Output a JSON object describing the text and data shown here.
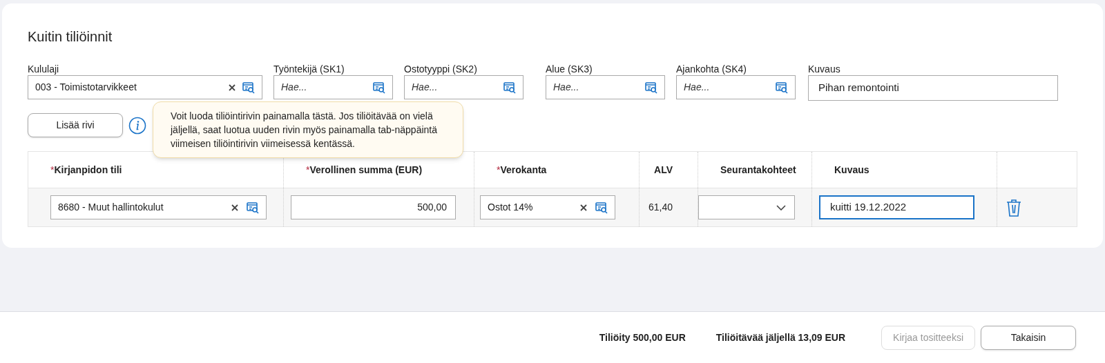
{
  "title": "Kuitin tiliöinnit",
  "filters": [
    {
      "label": "Kululaji",
      "value": "003 - Toimistotarvikkeet",
      "clearable": true
    },
    {
      "label": "Työntekijä (SK1)",
      "placeholder": "Hae...",
      "clearable": false
    },
    {
      "label": "Ostotyyppi (SK2)",
      "placeholder": "Hae...",
      "clearable": false
    },
    {
      "label": "Alue (SK3)",
      "placeholder": "Hae...",
      "clearable": false
    },
    {
      "label": "Ajankohta (SK4)",
      "placeholder": "Hae...",
      "clearable": false
    }
  ],
  "description": {
    "label": "Kuvaus",
    "value": "Pihan remontointi"
  },
  "add_row_button": "Lisää rivi",
  "tooltip": "Voit luoda tiliöintirivin painamalla tästä. Jos tiliöitävää on vielä jäljellä, saat luotua uuden rivin myös painamalla tab-näppäintä viimeisen tiliöintirivin viimeisessä kentässä.",
  "table": {
    "columns": [
      {
        "label": "Kirjanpidon tili",
        "required_mark": "*"
      },
      {
        "label": "Verollinen summa (EUR)",
        "required_mark": "*"
      },
      {
        "label": "Verokanta",
        "required_mark": "*"
      },
      {
        "label": "ALV"
      },
      {
        "label": "Seurantakohteet"
      },
      {
        "label": "Kuvaus"
      }
    ],
    "rows": [
      {
        "account": "8680 - Muut hallintokulut",
        "amount": "500,00",
        "tax_rate": "Ostot 14%",
        "vat": "61,40",
        "description": "kuitti 19.12.2022"
      }
    ]
  },
  "footer": {
    "posted": "Tiliöity 500,00 EUR",
    "remaining": "Tiliöitävää jäljellä 13,09 EUR",
    "buttons": [
      {
        "label": "Kirjaa tositteeksi",
        "disabled": true
      },
      {
        "label": "Takaisin",
        "disabled": false
      }
    ]
  }
}
